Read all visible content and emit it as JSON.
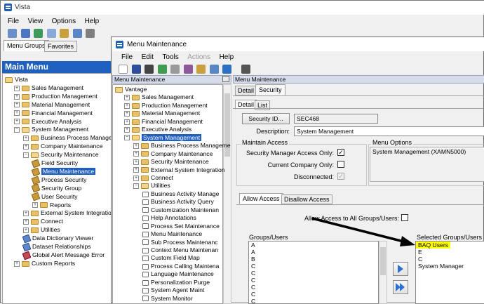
{
  "outer": {
    "title": "Vista",
    "menu": [
      "File",
      "View",
      "Options",
      "Help"
    ],
    "tabs": [
      "Menu Groups",
      "Favorites"
    ],
    "main_menu_title": "Main Menu",
    "tree": [
      {
        "label": "Vista",
        "indent": 0,
        "kind": "root"
      },
      {
        "label": "Sales Management",
        "indent": 1,
        "kind": "folder"
      },
      {
        "label": "Production Management",
        "indent": 1,
        "kind": "folder"
      },
      {
        "label": "Material Management",
        "indent": 1,
        "kind": "folder"
      },
      {
        "label": "Financial Management",
        "indent": 1,
        "kind": "folder"
      },
      {
        "label": "Executive Analysis",
        "indent": 1,
        "kind": "folder"
      },
      {
        "label": "System Management",
        "indent": 1,
        "kind": "folder-open"
      },
      {
        "label": "Business Process Managem",
        "indent": 2,
        "kind": "folder"
      },
      {
        "label": "Company Maintenance",
        "indent": 2,
        "kind": "folder"
      },
      {
        "label": "Security Maintenance",
        "indent": 2,
        "kind": "folder-open"
      },
      {
        "label": "Field Security",
        "indent": 3,
        "kind": "leaf"
      },
      {
        "label": "Menu Maintenance",
        "indent": 3,
        "kind": "leaf",
        "selected": true
      },
      {
        "label": "Process Security",
        "indent": 3,
        "kind": "leaf"
      },
      {
        "label": "Security Group",
        "indent": 3,
        "kind": "leaf"
      },
      {
        "label": "User Security",
        "indent": 3,
        "kind": "leaf"
      },
      {
        "label": "Reports",
        "indent": 3,
        "kind": "folder"
      },
      {
        "label": "External System Integration",
        "indent": 2,
        "kind": "folder"
      },
      {
        "label": "Connect",
        "indent": 2,
        "kind": "folder"
      },
      {
        "label": "Utilities",
        "indent": 2,
        "kind": "folder"
      },
      {
        "label": "Data Dictionary Viewer",
        "indent": 2,
        "kind": "leaf-blue"
      },
      {
        "label": "Dataset Relationships",
        "indent": 2,
        "kind": "leaf-blue"
      },
      {
        "label": "Global Alert Message Error",
        "indent": 2,
        "kind": "leaf-red"
      },
      {
        "label": "Custom Reports",
        "indent": 1,
        "kind": "folder"
      }
    ]
  },
  "inner": {
    "title": "Menu Maintenance",
    "menu": [
      "File",
      "Edit",
      "Tools",
      "Actions",
      "Help"
    ],
    "left_panel_header": "Menu Maintenance",
    "right_panel_header": "Menu Maintenance",
    "tree": [
      {
        "label": "Vantage",
        "indent": 0,
        "kind": "root"
      },
      {
        "label": "Sales Management",
        "indent": 1,
        "kind": "folder"
      },
      {
        "label": "Production Management",
        "indent": 1,
        "kind": "folder"
      },
      {
        "label": "Material Management",
        "indent": 1,
        "kind": "folder"
      },
      {
        "label": "Financial Management",
        "indent": 1,
        "kind": "folder"
      },
      {
        "label": "Executive Analysis",
        "indent": 1,
        "kind": "folder"
      },
      {
        "label": "System Management",
        "indent": 1,
        "kind": "folder-open",
        "selected": true
      },
      {
        "label": "Business Process Manageme",
        "indent": 2,
        "kind": "folder"
      },
      {
        "label": "Company Maintenance",
        "indent": 2,
        "kind": "folder"
      },
      {
        "label": "Security Maintenance",
        "indent": 2,
        "kind": "folder"
      },
      {
        "label": "External System Integration",
        "indent": 2,
        "kind": "folder"
      },
      {
        "label": "Connect",
        "indent": 2,
        "kind": "folder"
      },
      {
        "label": "Utilities",
        "indent": 2,
        "kind": "folder-open"
      },
      {
        "label": "Business Activity Manage",
        "indent": 3,
        "kind": "page"
      },
      {
        "label": "Business Activity Query",
        "indent": 3,
        "kind": "page"
      },
      {
        "label": "Customization Maintenan",
        "indent": 3,
        "kind": "page"
      },
      {
        "label": "Help Annotations",
        "indent": 3,
        "kind": "page"
      },
      {
        "label": "Process Set Maintenance",
        "indent": 3,
        "kind": "page"
      },
      {
        "label": "Menu Maintenance",
        "indent": 3,
        "kind": "page"
      },
      {
        "label": "Sub Process Maintenanc",
        "indent": 3,
        "kind": "page"
      },
      {
        "label": "Context Menu Maintenan",
        "indent": 3,
        "kind": "page"
      },
      {
        "label": "Custom Field Map",
        "indent": 3,
        "kind": "page"
      },
      {
        "label": "Process Calling Maintena",
        "indent": 3,
        "kind": "page"
      },
      {
        "label": "Language Maintenance",
        "indent": 3,
        "kind": "page"
      },
      {
        "label": "Personalization Purge",
        "indent": 3,
        "kind": "page"
      },
      {
        "label": "System Agent Maint",
        "indent": 3,
        "kind": "page"
      },
      {
        "label": "System Monitor",
        "indent": 3,
        "kind": "page"
      }
    ],
    "tabs_top": [
      "Detail",
      "Security"
    ],
    "tabs_sub": [
      "Detail",
      "List"
    ],
    "security_id_button": "Security ID...",
    "security_id_value": "SEC468",
    "description_label": "Description:",
    "description_value": "System Management",
    "maintain_access_title": "Maintain Access",
    "checks": [
      {
        "label": "Security Manager Access Only:",
        "checked": true,
        "disabled": false
      },
      {
        "label": "Current Company Only:",
        "checked": false,
        "disabled": false
      },
      {
        "label": "Disconnected:",
        "checked": true,
        "disabled": true
      }
    ],
    "menu_options_title": "Menu Options",
    "menu_options_value": "System Management (XAMN5000)",
    "tabs_access": [
      "Allow Access",
      "Disallow Access"
    ],
    "allow_all_label": "Allow Access to All Groups/Users:",
    "groups_users_label": "Groups/Users",
    "groups_users": [
      "A",
      "A",
      "B",
      "C",
      "C",
      "C",
      "C",
      "C",
      "C"
    ],
    "selected_groups_label": "Selected Groups/Users",
    "selected_groups": [
      "BAQ Users",
      "E",
      "C",
      "System Manager"
    ],
    "highlight_color": "#ffff00",
    "accent_color": "#1e5fc0"
  }
}
